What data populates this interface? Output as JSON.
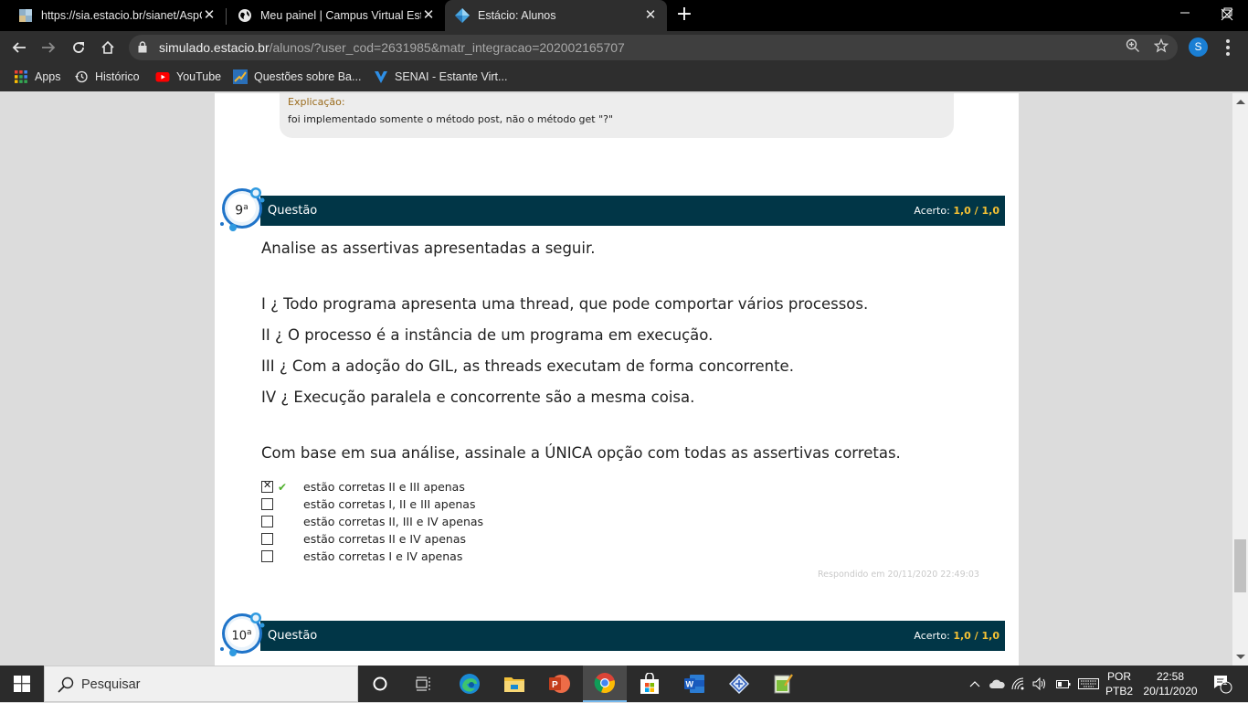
{
  "browser": {
    "tabs": [
      {
        "title": "https://sia.estacio.br/sianet/AspC",
        "icon": "map-favicon",
        "active": false
      },
      {
        "title": "Meu painel | Campus Virtual Está",
        "icon": "globe-icon",
        "active": false
      },
      {
        "title": "Estácio: Alunos",
        "icon": "estacio-diamond-icon",
        "active": true
      }
    ],
    "new_tab_label": "+",
    "window_controls": {
      "minimize": "—",
      "restore": "❐",
      "close": "✕"
    },
    "url_host": "simulado.estacio.br",
    "url_path": "/alunos/?user_cod=2631985&matr_integracao=202002165707",
    "avatar_letter": "S",
    "bookmarks": [
      {
        "label": "Apps",
        "icon": "apps-grid-icon"
      },
      {
        "label": "Histórico",
        "icon": "history-icon"
      },
      {
        "label": "YouTube",
        "icon": "youtube-icon"
      },
      {
        "label": "Questões sobre Ba...",
        "icon": "chart-bookmark-icon"
      },
      {
        "label": "SENAI - Estante Virt...",
        "icon": "senai-icon"
      }
    ]
  },
  "page": {
    "explanation": {
      "label": "Explicação:",
      "text": "foi implementado somente o método post, não o método get  \"?\""
    },
    "questions": [
      {
        "number": "9",
        "ordinal": "a",
        "header_label": "Questão",
        "score_label": "Acerto:",
        "score_value": "1,0",
        "score_sep": " / ",
        "score_max": "1,0",
        "intro": "Analise as assertivas apresentadas a seguir.",
        "assertions": [
          "I ¿ Todo programa apresenta uma thread, que pode comportar vários processos.",
          "II ¿ O processo é a instância de um programa em execução.",
          "III ¿ Com a adoção do GIL, as threads executam de forma concorrente.",
          "IV ¿ Execução paralela e concorrente são a mesma coisa."
        ],
        "prompt": "Com base em sua análise, assinale a ÚNICA opção com todas as assertivas corretas.",
        "options": [
          {
            "text": "estão corretas II e III apenas",
            "checked": true,
            "correct": true
          },
          {
            "text": "estão corretas I, II e III apenas",
            "checked": false,
            "correct": false
          },
          {
            "text": "estão corretas II, III e IV apenas",
            "checked": false,
            "correct": false
          },
          {
            "text": "estão corretas II e IV apenas",
            "checked": false,
            "correct": false
          },
          {
            "text": "estão corretas I e IV apenas",
            "checked": false,
            "correct": false
          }
        ],
        "answered_at": "Respondido em 20/11/2020 22:49:03"
      },
      {
        "number": "10",
        "ordinal": "a",
        "header_label": "Questão",
        "score_label": "Acerto:",
        "score_value": "1,0",
        "score_sep": " / ",
        "score_max": "1,0"
      }
    ],
    "colors": {
      "question_bar": "#013647",
      "score_highlight": "#f6c234",
      "explanation_label": "#9a6b1c",
      "correct_check": "#4fb02c"
    }
  },
  "taskbar": {
    "search_placeholder": "Pesquisar",
    "apps": [
      "cortana-icon",
      "task-view-icon",
      "edge-icon",
      "file-explorer-icon",
      "powerpoint-icon",
      "chrome-icon",
      "store-icon",
      "word-icon",
      "network-app-icon",
      "notepad-app-icon"
    ],
    "active_app": "chrome-icon",
    "language_top": "POR",
    "language_bottom": "PTB2",
    "time": "22:58",
    "date": "20/11/2020",
    "notification_count": "1"
  }
}
